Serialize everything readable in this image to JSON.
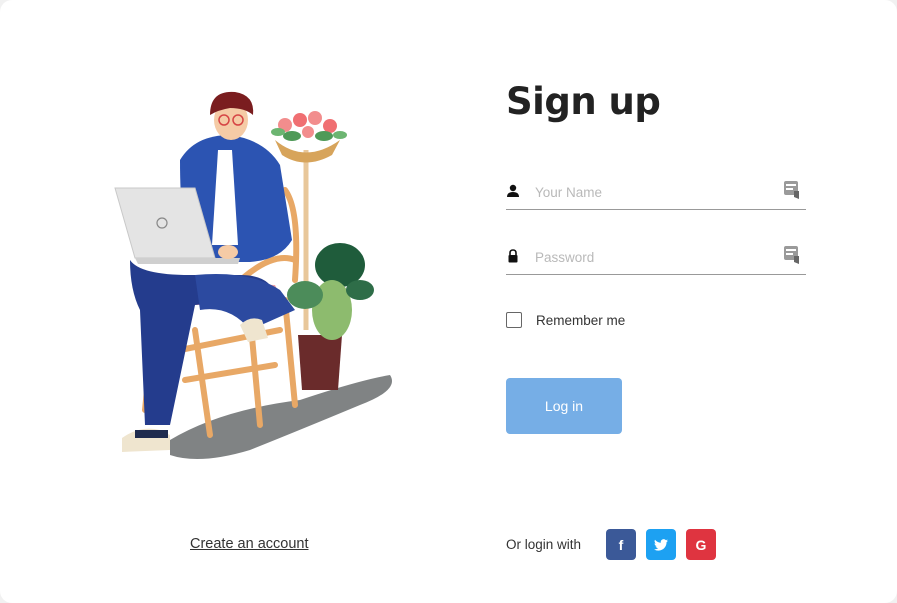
{
  "form": {
    "title": "Sign up",
    "name_placeholder": "Your Name",
    "name_value": "",
    "password_placeholder": "Password",
    "password_value": "",
    "remember_label": "Remember me",
    "remember_checked": false,
    "login_label": "Log in"
  },
  "footer": {
    "create_account": "Create an account",
    "or_login_with": "Or login with"
  },
  "social": [
    {
      "name": "facebook",
      "glyph": "f",
      "color": "#3b5998"
    },
    {
      "name": "twitter",
      "glyph": "twitter-bird-icon",
      "color": "#1da1f2"
    },
    {
      "name": "google",
      "glyph": "G",
      "color": "#df3440"
    }
  ],
  "icons": {
    "name_field": "user-icon",
    "password_field": "lock-icon",
    "autofill": "key-icon"
  },
  "colors": {
    "login_button": "#76aee6",
    "background": "#ffffff"
  }
}
